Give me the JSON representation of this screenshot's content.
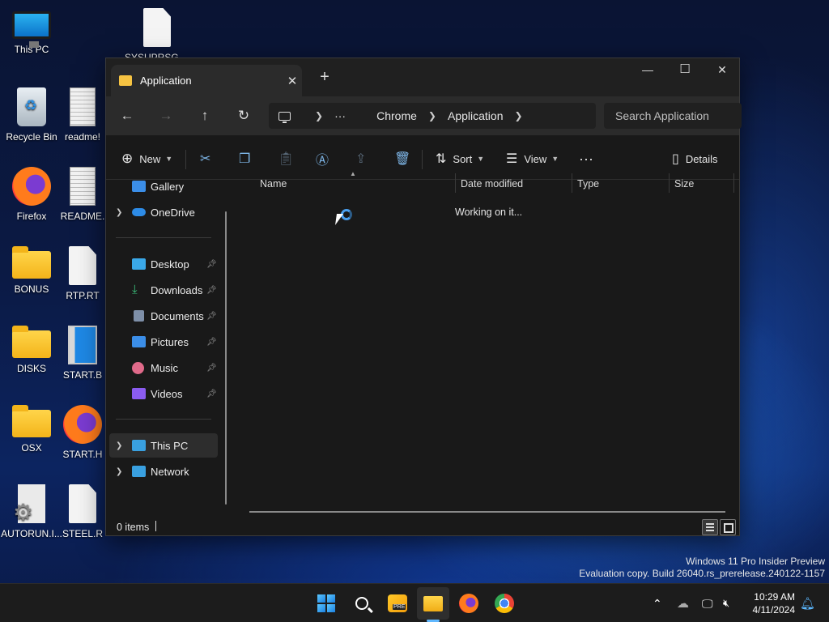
{
  "desktop": {
    "icons": [
      {
        "label": "This PC",
        "icon": "monitor-icon"
      },
      {
        "label": "SYSUPRSG....",
        "icon": "document-icon"
      },
      {
        "label": "Recycle Bin",
        "icon": "recycle-bin-icon"
      },
      {
        "label": "readme!",
        "icon": "text-file-icon"
      },
      {
        "label": "Firefox",
        "icon": "firefox-icon"
      },
      {
        "label": "README.",
        "icon": "text-file-icon"
      },
      {
        "label": "BONUS",
        "icon": "folder-icon"
      },
      {
        "label": "RTP.RT",
        "icon": "document-icon"
      },
      {
        "label": "DISKS",
        "icon": "folder-icon"
      },
      {
        "label": "START.B",
        "icon": "app-icon"
      },
      {
        "label": "OSX",
        "icon": "folder-icon"
      },
      {
        "label": "START.H",
        "icon": "firefox-shortcut-icon"
      },
      {
        "label": "AUTORUN.I...",
        "icon": "settings-file-icon"
      },
      {
        "label": "STEEL.R",
        "icon": "document-icon"
      }
    ]
  },
  "explorer": {
    "tab_title": "Application",
    "new_tab": "+",
    "window_controls": {
      "minimize": "—",
      "maximize": "☐",
      "close": "✕"
    },
    "nav": {
      "back": "←",
      "forward": "→",
      "up": "↑",
      "refresh": "↻"
    },
    "breadcrumb": {
      "ellipsis": "···",
      "items": [
        "Chrome",
        "Application"
      ]
    },
    "search_placeholder": "Search Application",
    "toolbar": {
      "new_label": "New",
      "sort_label": "Sort",
      "view_label": "View",
      "more": "···",
      "details_label": "Details"
    },
    "sidebar": {
      "top": [
        {
          "label": "Gallery",
          "icon": "gallery-icon",
          "color": "#3b8ee8"
        },
        {
          "label": "OneDrive",
          "icon": "cloud-icon",
          "color": "#2d8be6",
          "expandable": true
        }
      ],
      "quick_access": [
        {
          "label": "Desktop",
          "icon": "desktop-icon",
          "color": "#3aa8e8"
        },
        {
          "label": "Downloads",
          "icon": "download-icon",
          "color": "#3bbf7a"
        },
        {
          "label": "Documents",
          "icon": "documents-icon",
          "color": "#7e8fa8"
        },
        {
          "label": "Pictures",
          "icon": "pictures-icon",
          "color": "#3b8ee8"
        },
        {
          "label": "Music",
          "icon": "music-icon",
          "color": "#e06a8a"
        },
        {
          "label": "Videos",
          "icon": "videos-icon",
          "color": "#8b5cf0"
        }
      ],
      "locations": [
        {
          "label": "This PC",
          "icon": "this-pc-icon",
          "color": "#39a0e0"
        },
        {
          "label": "Network",
          "icon": "network-icon",
          "color": "#39a0e0"
        }
      ]
    },
    "columns": [
      "Name",
      "Date modified",
      "Type",
      "Size"
    ],
    "status_message": "Working on it...",
    "status_bar": {
      "item_count": "0 items"
    }
  },
  "watermark": {
    "line1": "Windows 11 Pro Insider Preview",
    "line2": "Evaluation copy. Build 26040.rs_prerelease.240122-1157"
  },
  "taskbar": {
    "apps": [
      "start-icon",
      "search-icon",
      "pre-app-icon",
      "file-explorer-icon",
      "firefox-icon",
      "chrome-icon"
    ],
    "clock": {
      "time": "10:29 AM",
      "date": "4/11/2024"
    }
  }
}
